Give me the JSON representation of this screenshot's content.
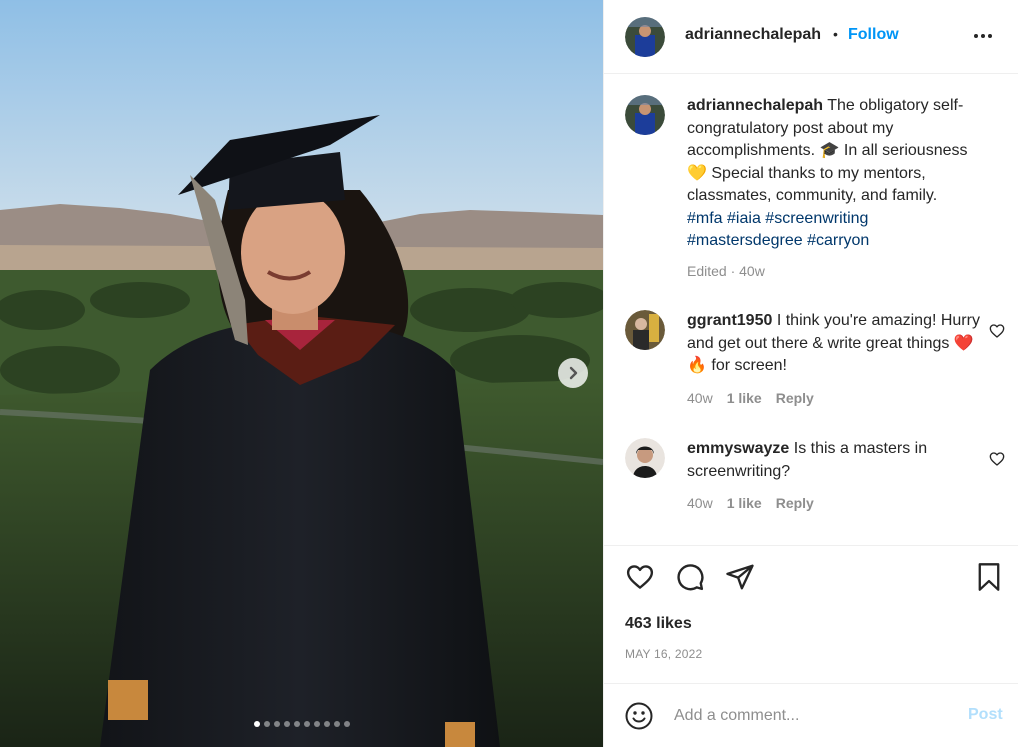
{
  "post": {
    "author": "adriannechalepah",
    "follow_sep": "•",
    "follow_label": "Follow",
    "more_icon": "more-horizontal-icon",
    "caption": {
      "text1": "The obligatory self-congratulatory post about my accomplishments.",
      "emoji1": "🎓",
      "text2": "In all seriousness",
      "emoji2": "💛",
      "text3": "Special thanks to my mentors, classmates, community, and family.",
      "hashtags": [
        "#mfa",
        "#iaia",
        "#screenwriting",
        "#mastersdegree",
        "#carryon"
      ],
      "meta": "Edited · 40w"
    },
    "comments": [
      {
        "user": "ggrant1950",
        "text1": "I think you're amazing! Hurry and get out there & write great things",
        "emoji": "❤️🔥",
        "text2": "for screen!",
        "age": "40w",
        "likes": "1 like",
        "reply": "Reply"
      },
      {
        "user": "emmyswayze",
        "text1": "Is this a masters in screenwriting?",
        "age": "40w",
        "likes": "1 like",
        "reply": "Reply"
      }
    ],
    "likes": "463 likes",
    "date": "MAY 16, 2022",
    "add_comment_placeholder": "Add a comment...",
    "post_label": "Post",
    "carousel": {
      "slide_count": 10,
      "active_slide": 1
    }
  },
  "colors": {
    "link_blue": "#0095f6",
    "hashtag": "#00376b",
    "muted": "#8e8e8e",
    "post_disabled": "#b2dffc"
  }
}
